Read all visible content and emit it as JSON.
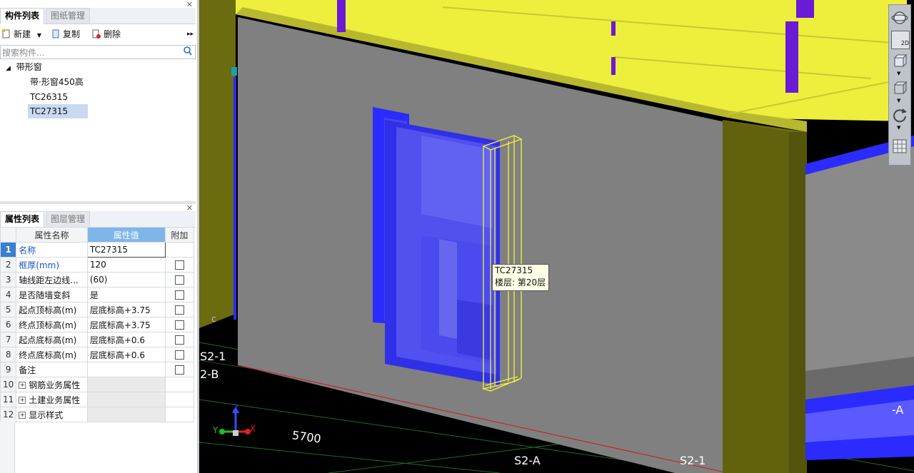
{
  "component_panel": {
    "tabs": [
      {
        "label": "构件列表"
      },
      {
        "label": "图纸管理"
      }
    ],
    "toolbar": {
      "new": "新建",
      "copy": "复制",
      "delete": "删除"
    },
    "search_placeholder": "搜索构件...",
    "tree": {
      "root": "带形窗",
      "items": [
        {
          "label": "带·形窗450高"
        },
        {
          "label": "TC26315"
        },
        {
          "label": "TC27315"
        }
      ]
    }
  },
  "property_panel": {
    "tabs": [
      {
        "label": "属性列表"
      },
      {
        "label": "图层管理"
      }
    ],
    "columns": {
      "name": "属性名称",
      "value": "属性值",
      "extra": "附加"
    },
    "rows": [
      {
        "num": "1",
        "name": "名称",
        "value": "TC27315"
      },
      {
        "num": "2",
        "name": "框厚(mm)",
        "value": "120"
      },
      {
        "num": "3",
        "name": "轴线距左边线...",
        "value": "(60)"
      },
      {
        "num": "4",
        "name": "是否随墙变斜",
        "value": "是"
      },
      {
        "num": "5",
        "name": "起点顶标高(m)",
        "value": "层底标高+3.75"
      },
      {
        "num": "6",
        "name": "终点顶标高(m)",
        "value": "层底标高+3.75"
      },
      {
        "num": "7",
        "name": "起点底标高(m)",
        "value": "层底标高+0.6"
      },
      {
        "num": "8",
        "name": "终点底标高(m)",
        "value": "层底标高+0.6"
      },
      {
        "num": "9",
        "name": "备注",
        "value": ""
      },
      {
        "num": "10",
        "name": "钢筋业务属性",
        "value": ""
      },
      {
        "num": "11",
        "name": "土建业务属性",
        "value": ""
      },
      {
        "num": "12",
        "name": "显示样式",
        "value": ""
      }
    ]
  },
  "viewport": {
    "tooltip": {
      "line1": "TC27315",
      "line2": "楼层: 第20层"
    },
    "labels": {
      "s21_top": "S2-1",
      "s2b": "2-B",
      "dim": "5700",
      "s2a": "S2-A",
      "s21_bottom": "S2-1",
      "right_a": "-A",
      "c": "c"
    },
    "axes": {
      "z": "Z",
      "y": "Y",
      "x": "X"
    },
    "toolbar_2d": "2D"
  },
  "colors": {
    "accent": "#3a7fd1",
    "wall": "#808080",
    "window": "#2b2bff",
    "slab": "#f0f040",
    "column": "#6b6b10"
  }
}
